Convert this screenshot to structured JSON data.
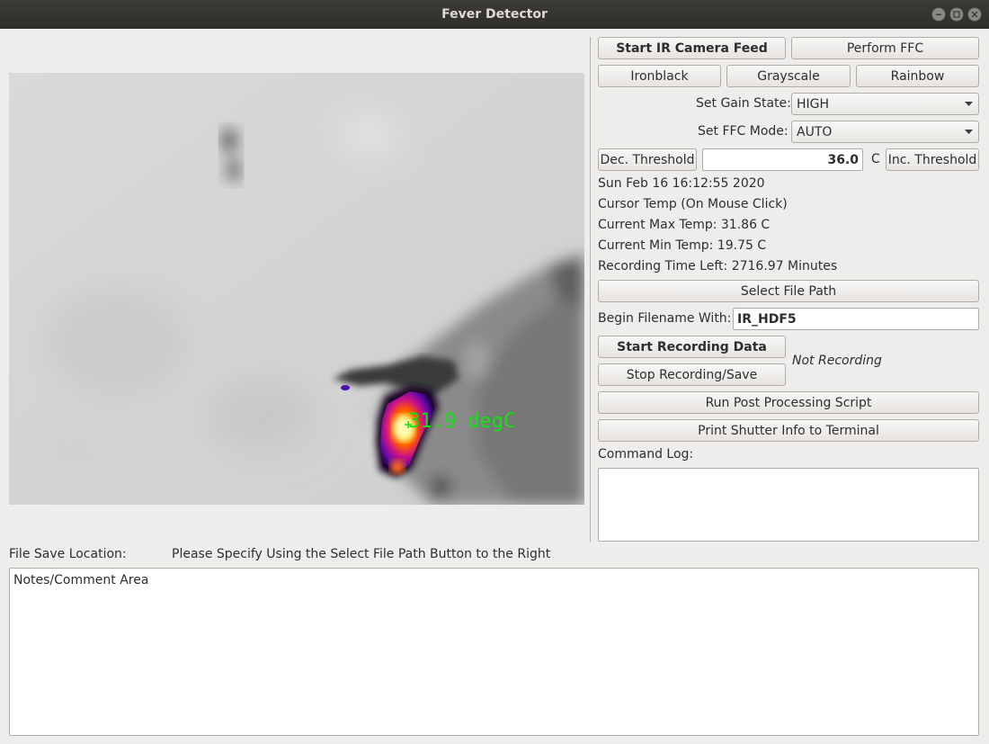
{
  "window": {
    "title": "Fever Detector"
  },
  "camera": {
    "overlay_text": "31.9 degC"
  },
  "controls": {
    "start_feed_label": "Start IR Camera Feed",
    "perform_ffc_label": "Perform FFC",
    "palettes": [
      "Ironblack",
      "Grayscale",
      "Rainbow"
    ],
    "gain_label": "Set Gain State:",
    "gain_value": "HIGH",
    "ffc_mode_label": "Set FFC Mode:",
    "ffc_mode_value": "AUTO",
    "dec_threshold_label": "Dec. Threshold",
    "threshold_value": "36.0",
    "threshold_unit": "C",
    "inc_threshold_label": "Inc. Threshold"
  },
  "status": {
    "datetime": "Sun Feb 16 16:12:55 2020",
    "cursor_temp": "Cursor Temp (On Mouse Click)",
    "max_temp": "Current Max Temp: 31.86 C",
    "min_temp": "Current Min Temp: 19.75 C",
    "recording_time_left": "Recording Time Left: 2716.97 Minutes"
  },
  "recording": {
    "select_path_label": "Select File Path",
    "filename_label": "Begin Filename With:",
    "filename_value": "IR_HDF5",
    "start_label": "Start Recording Data",
    "stop_label": "Stop Recording/Save",
    "state_text": "Not Recording",
    "post_process_label": "Run Post Processing Script",
    "print_shutter_label": "Print Shutter Info to Terminal",
    "command_log_label": "Command Log:",
    "command_log_value": ""
  },
  "footer": {
    "save_location_label": "File Save Location:",
    "save_location_value": "Please Specify Using the Select File Path Button to the Right",
    "notes_placeholder": "Notes/Comment Area"
  },
  "colors": {
    "titlebar": "#2f2e2a",
    "window_bg": "#efedeb",
    "overlay_green": "#12e212"
  },
  "icons": [
    "minimize-icon",
    "maximize-icon",
    "close-icon",
    "chevron-down-icon"
  ]
}
